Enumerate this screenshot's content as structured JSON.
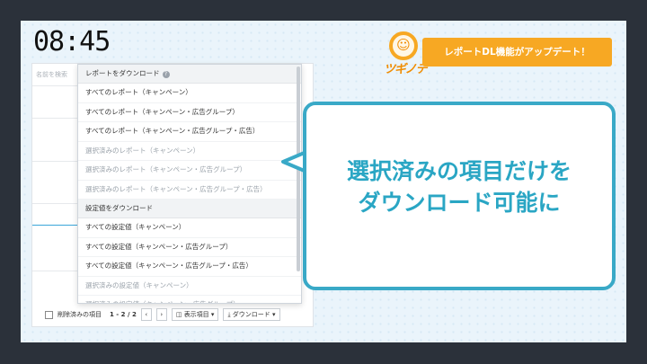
{
  "clock": "08:45",
  "search_placeholder": "名前を検索",
  "dropdown": {
    "report_section": "レポートをダウンロード",
    "report_items": [
      {
        "label": "すべてのレポート（キャンペーン）",
        "disabled": false
      },
      {
        "label": "すべてのレポート（キャンペーン・広告グループ）",
        "disabled": false
      },
      {
        "label": "すべてのレポート（キャンペーン・広告グループ・広告）",
        "disabled": false
      },
      {
        "label": "選択済みのレポート（キャンペーン）",
        "disabled": true
      },
      {
        "label": "選択済みのレポート（キャンペーン・広告グループ）",
        "disabled": true
      },
      {
        "label": "選択済みのレポート（キャンペーン・広告グループ・広告）",
        "disabled": true
      }
    ],
    "settings_section": "設定値をダウンロード",
    "settings_items": [
      {
        "label": "すべての設定値（キャンペーン）",
        "disabled": false
      },
      {
        "label": "すべての設定値（キャンペーン・広告グループ）",
        "disabled": false
      },
      {
        "label": "すべての設定値（キャンペーン・広告グループ・広告）",
        "disabled": false
      },
      {
        "label": "選択済みの設定値（キャンペーン）",
        "disabled": true
      },
      {
        "label": "選択済みの設定値（キャンペーン・広告グループ）",
        "disabled": true
      }
    ]
  },
  "footer": {
    "deleted_items": "削除済みの項目",
    "pager": "1 - 2 / 2",
    "prev": "‹",
    "next": "›",
    "display_items": "表示項目",
    "download": "ダウンロード"
  },
  "logo_text": "ツギノテ",
  "banner": "レポートDL機能がアップデート！",
  "bubble": {
    "line1": "選択済みの項目だけを",
    "line2": "ダウンロード可能に"
  },
  "colors": {
    "accent_orange": "#f7a823",
    "bubble_blue": "#39a9c7",
    "frame": "#2b313a"
  }
}
